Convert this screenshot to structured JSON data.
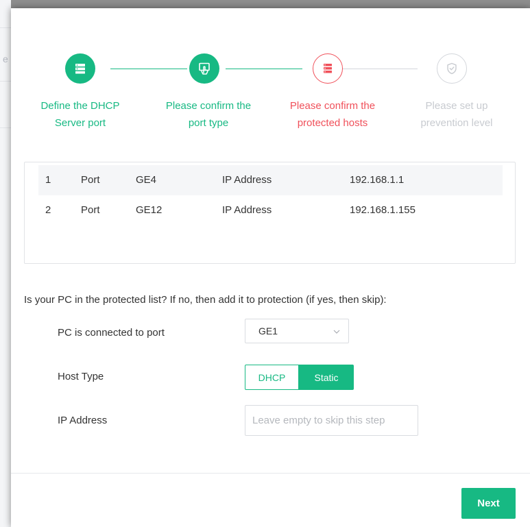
{
  "stepper": {
    "steps": [
      {
        "label_line1": "Define the DHCP",
        "label_line2": "Server port",
        "state": "done",
        "icon": "server-icon"
      },
      {
        "label_line1": "Please confirm the",
        "label_line2": "port type",
        "state": "done",
        "icon": "touch-screen-icon"
      },
      {
        "label_line1": "Please confirm the",
        "label_line2": "protected hosts",
        "state": "current",
        "icon": "host-list-icon"
      },
      {
        "label_line1": "Please set up",
        "label_line2": "prevention level",
        "state": "todo",
        "icon": "shield-check-icon"
      }
    ]
  },
  "hosts": {
    "rows": [
      {
        "index": "1",
        "port_label": "Port",
        "port": "GE4",
        "ip_label": "IP Address",
        "ip": "192.168.1.1"
      },
      {
        "index": "2",
        "port_label": "Port",
        "port": "GE12",
        "ip_label": "IP Address",
        "ip": "192.168.1.155"
      }
    ]
  },
  "form": {
    "question": "Is your PC in the protected list? If no, then add it to protection (if yes, then skip):",
    "port_label": "PC is connected to port",
    "port_value": "GE1",
    "host_type_label": "Host Type",
    "host_type_options": [
      "DHCP",
      "Static"
    ],
    "host_type_selected": "Static",
    "ip_label": "IP Address",
    "ip_placeholder": "Leave empty to skip this step",
    "ip_value": ""
  },
  "footer": {
    "next_label": "Next"
  },
  "backdrop": {
    "partial_char": "e"
  },
  "colors": {
    "accent": "#17b983",
    "current": "#f0505a",
    "inactive": "#c8cbd0"
  }
}
